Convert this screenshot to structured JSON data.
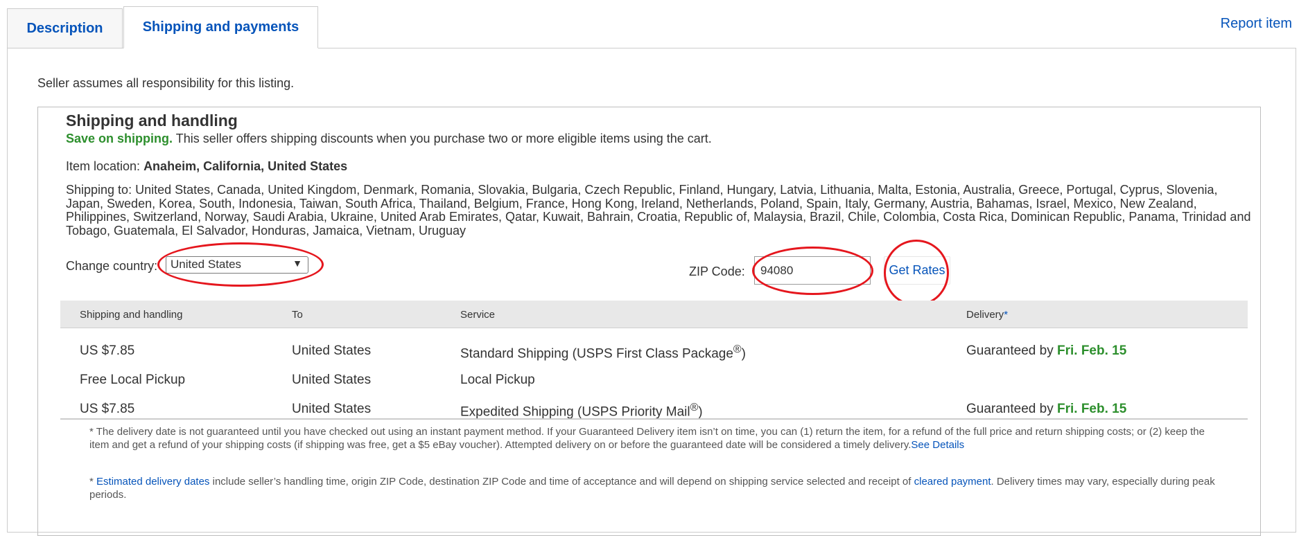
{
  "tabs": [
    {
      "label": "Description"
    },
    {
      "label": "Shipping and payments"
    }
  ],
  "report_item": "Report item",
  "disclaimer": "Seller assumes all responsibility for this listing.",
  "shipping": {
    "title": "Shipping and handling",
    "promo_bold": "Save on shipping.",
    "promo_text": " This seller offers shipping discounts when you purchase two or more eligible items using the cart.",
    "location_label": "Item location: ",
    "location_value": "Anaheim, California, United States",
    "ship_to": "Shipping to: United States, Canada, United Kingdom, Denmark, Romania, Slovakia, Bulgaria, Czech Republic, Finland, Hungary, Latvia, Lithuania, Malta, Estonia, Australia, Greece, Portugal, Cyprus, Slovenia, Japan, Sweden, Korea, South, Indonesia, Taiwan, South Africa, Thailand, Belgium, France, Hong Kong, Ireland, Netherlands, Poland, Spain, Italy, Germany, Austria, Bahamas, Israel, Mexico, New Zealand, Philippines, Switzerland, Norway, Saudi Arabia, Ukraine, United Arab Emirates, Qatar, Kuwait, Bahrain, Croatia, Republic of, Malaysia, Brazil, Chile, Colombia, Costa Rica, Dominican Republic, Panama, Trinidad and Tobago, Guatemala, El Salvador, Honduras, Jamaica, Vietnam, Uruguay",
    "change_country_label": "Change country:",
    "country_value": "United States",
    "zip_label": "ZIP Code:",
    "zip_value": "94080",
    "get_rates": "Get Rates"
  },
  "table": {
    "headers": {
      "cost": "Shipping and handling",
      "to": "To",
      "service": "Service",
      "delivery": "Delivery",
      "delivery_star": "*"
    },
    "rows": [
      {
        "cost": "US $7.85",
        "to": "United States",
        "service": "Standard Shipping (USPS First Class Package",
        "reg": "®",
        "service_end": ")",
        "delivery_prefix": "Guaranteed by ",
        "delivery_date": "Fri. Feb. 15"
      },
      {
        "cost": "Free Local Pickup",
        "to": "United States",
        "service": "Local Pickup",
        "reg": "",
        "service_end": "",
        "delivery_prefix": "",
        "delivery_date": ""
      },
      {
        "cost": "US $7.85",
        "to": "United States",
        "service": "Expedited Shipping (USPS Priority Mail",
        "reg": "®",
        "service_end": ")",
        "delivery_prefix": "Guaranteed by ",
        "delivery_date": "Fri. Feb. 15"
      }
    ]
  },
  "notes": {
    "note1_text": "* The delivery date is not guaranteed until you have checked out using an instant payment method. If your Guaranteed Delivery item isn’t on time, you can (1) return the item, for a refund of the full price and return shipping costs; or (2) keep the item and get a refund of your shipping costs (if shipping was free, get a $5 eBay voucher). Attempted delivery on or before the guaranteed date will be considered a timely delivery.",
    "note1_link": "See Details",
    "note2_prefix": "* ",
    "note2_link1": "Estimated delivery dates",
    "note2_mid": " include seller’s handling time, origin ZIP Code, destination ZIP Code and time of acceptance and will depend on shipping service selected and receipt of ",
    "note2_link2": "cleared payment",
    "note2_end": ". Delivery times may vary, especially during peak periods."
  },
  "annotation_color": "#e5161d"
}
